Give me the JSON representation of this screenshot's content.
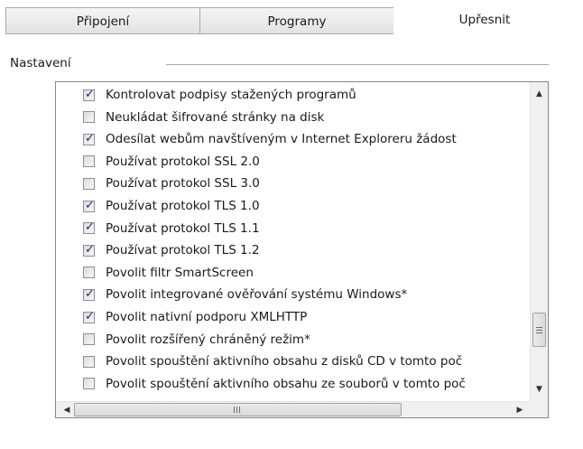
{
  "tabs": [
    {
      "label": "Připojení",
      "active": false
    },
    {
      "label": "Programy",
      "active": false
    },
    {
      "label": "Upřesnit",
      "active": true
    }
  ],
  "section": {
    "label": "Nastavení"
  },
  "settings": [
    {
      "label": "Kontrolovat podpisy stažených programů",
      "checked": true
    },
    {
      "label": "Neukládat šifrované stránky na disk",
      "checked": false
    },
    {
      "label": "Odesílat webům navštíveným v Internet Exploreru žádost",
      "checked": true
    },
    {
      "label": "Používat protokol SSL 2.0",
      "checked": false
    },
    {
      "label": "Používat protokol SSL 3.0",
      "checked": false
    },
    {
      "label": "Používat protokol TLS 1.0",
      "checked": true
    },
    {
      "label": "Používat protokol TLS 1.1",
      "checked": true
    },
    {
      "label": "Používat protokol TLS 1.2",
      "checked": true
    },
    {
      "label": "Povolit filtr SmartScreen",
      "checked": false
    },
    {
      "label": "Povolit integrované ověřování systému Windows*",
      "checked": true
    },
    {
      "label": "Povolit nativní podporu XMLHTTP",
      "checked": true
    },
    {
      "label": "Povolit rozšířený chráněný režim*",
      "checked": false
    },
    {
      "label": "Povolit spouštění aktivního obsahu z disků CD v tomto poč",
      "checked": false
    },
    {
      "label": "Povolit spouštění aktivního obsahu ze souborů v tomto poč",
      "checked": false
    }
  ],
  "scroll": {
    "up_glyph": "▲",
    "down_glyph": "▼",
    "left_glyph": "◀",
    "right_glyph": "▶",
    "vertical_position": 0.78
  }
}
